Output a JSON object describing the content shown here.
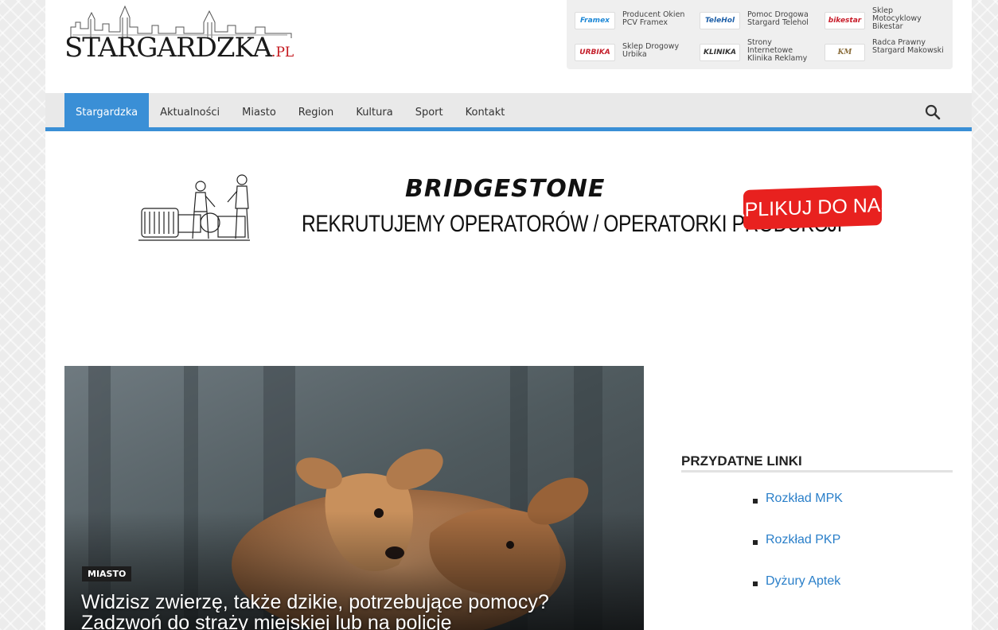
{
  "header": {
    "logo_text_main": "Stargardzka",
    "logo_text_suffix": ".pl"
  },
  "partners": [
    {
      "logo": "Framex",
      "name": "Producent Okien PCV Framex"
    },
    {
      "logo": "TeleHol",
      "name": "Pomoc Drogowa Stargard Telehol"
    },
    {
      "logo": "bikestar",
      "name": "Sklep Motocyklowy Bikestar"
    },
    {
      "logo": "URBIKA",
      "name": "Sklep Drogowy Urbika"
    },
    {
      "logo": "KLINIKA",
      "name": "Strony Internetowe Klinika Reklamy"
    },
    {
      "logo": "KM",
      "name": "Radca Prawny Stargard Makowski"
    }
  ],
  "nav": {
    "items": [
      "Stargardzka",
      "Aktualności",
      "Miasto",
      "Region",
      "Kultura",
      "Sport",
      "Kontakt"
    ],
    "active": "Stargardzka"
  },
  "banner": {
    "brand": "BRIDGESTONE",
    "headline": "REKRUTUJEMY OPERATORÓW / OPERATORKI PRODUKCJI",
    "cta": "APLIKUJ DO NAS"
  },
  "featured": {
    "category": "MIASTO",
    "title": "Widzisz zwierzę, także dzikie, potrzebujące pomocy? Zadzwoń do straży miejskiej lub na policję"
  },
  "sidebar": {
    "title": "PRZYDATNE LINKI",
    "links": [
      "Rozkład MPK",
      "Rozkład PKP",
      "Dyżury Aptek"
    ]
  },
  "colors": {
    "accent": "#3a8fd6",
    "cta": "#e8211f",
    "link": "#2a7fc9"
  }
}
